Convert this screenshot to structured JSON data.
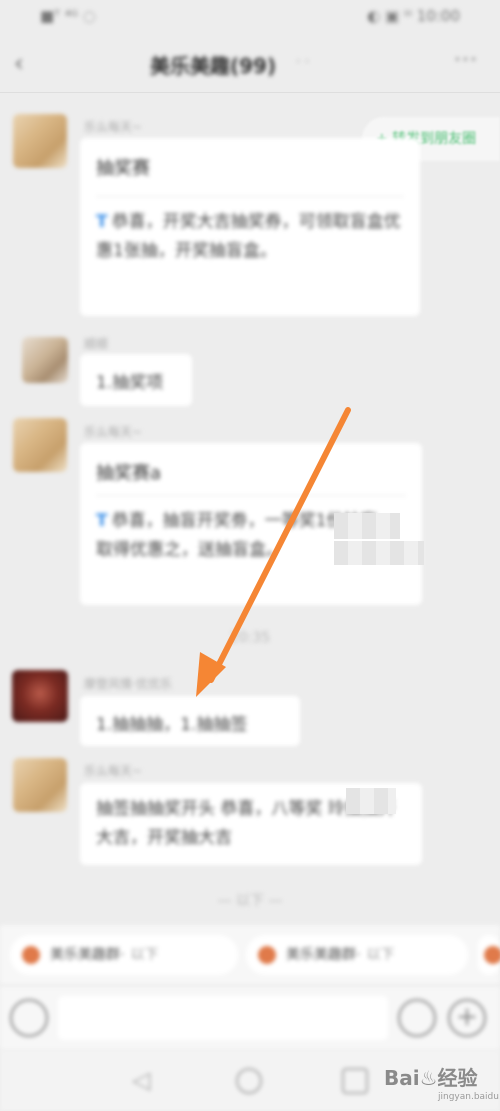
{
  "status_bar": {
    "left": "■ᵀ ⁴ᴳ ◌",
    "right": "◐ ▣ ⁱⁱⁱ 10:00"
  },
  "nav": {
    "title": "美乐美趣(99)",
    "title_suffix": "· ·",
    "more": "···"
  },
  "floating_chip": {
    "label": "+ 转发到朋友圈"
  },
  "messages": [
    {
      "sender": "乐么每天~",
      "title": "抽奖赛",
      "body": "恭喜，开奖大吉抽奖券，可领取盲盒优惠1张抽，开奖抽盲盒。",
      "tag": "T"
    },
    {
      "sender": "顺顺",
      "body": "1.抽奖项"
    },
    {
      "sender": "乐么每天~",
      "title": "抽奖赛a",
      "body": "恭喜，抽盲开奖劵，一等奖1份抽盲，取得优惠之，送抽盲盒。",
      "tag": "T"
    },
    {
      "sender": "摩登风情·优优乐",
      "body": "1.抽抽抽，1.抽抽签"
    },
    {
      "sender": "乐么每天~",
      "body": "抽签抽抽奖开头 恭喜，八等奖 玲抽抽开大吉，开奖抽大吉"
    }
  ],
  "time_separator": "20:35",
  "bottom_separator": "— 以下 —",
  "quick_chips": [
    {
      "label": "美乐美趣群·",
      "suffix": "以下"
    },
    {
      "label": "美乐美趣群·",
      "suffix": "以下"
    }
  ],
  "input": {
    "placeholder": "",
    "plus": "+"
  },
  "system_nav": {
    "back": "◁"
  },
  "watermark": {
    "brand": "Bai♨经验",
    "sub": "jingyan.baidu.com"
  },
  "colors": {
    "accent_green": "#4bbf73",
    "tag_blue": "#3a8fe8",
    "arrow_orange": "#f58634"
  }
}
